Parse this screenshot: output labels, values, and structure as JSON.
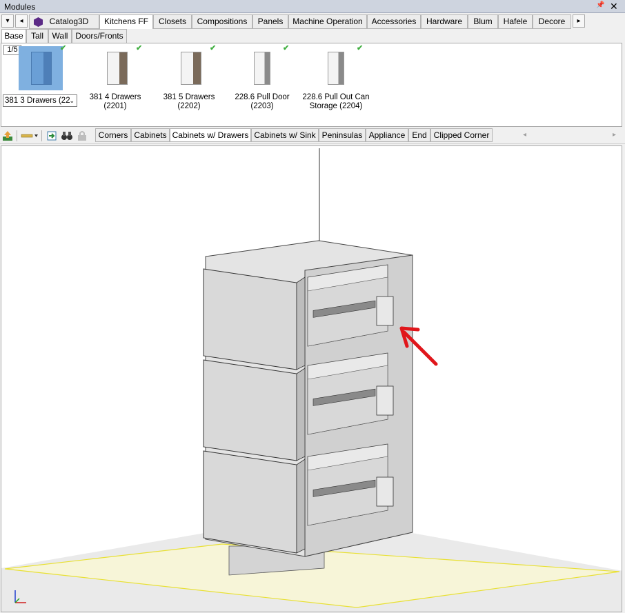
{
  "window": {
    "title": "Modules",
    "pin_glyph": "📌",
    "close_glyph": "✕"
  },
  "catalog_tabs": {
    "nav_down": "▾",
    "nav_left": "◂",
    "nav_right": "▸",
    "items": [
      {
        "label": "Catalog3D"
      },
      {
        "label": "Kitchens FF"
      },
      {
        "label": "Closets"
      },
      {
        "label": "Compositions"
      },
      {
        "label": "Panels"
      },
      {
        "label": "Machine Operation"
      },
      {
        "label": "Accessories"
      },
      {
        "label": "Hardware"
      },
      {
        "label": "Blum"
      },
      {
        "label": "Hafele"
      },
      {
        "label": "Decore"
      }
    ],
    "active": "Kitchens FF"
  },
  "sub_tabs": {
    "items": [
      {
        "label": "Base"
      },
      {
        "label": "Tall"
      },
      {
        "label": "Wall"
      },
      {
        "label": "Doors/Fronts"
      }
    ],
    "active": "Base"
  },
  "gallery": {
    "page_counter": "1/5",
    "items": [
      {
        "label": "381 3 Drawers (22",
        "selected": true
      },
      {
        "label": "381 4 Drawers (2201)"
      },
      {
        "label": "381 5 Drawers (2202)"
      },
      {
        "label": "228.6 Pull Door (2203)"
      },
      {
        "label": "228.6 Pull Out Can Storage (2204)"
      }
    ],
    "check_glyph": "✔",
    "combo_chevron": "⌄"
  },
  "category_tabs": {
    "items": [
      {
        "label": "Corners"
      },
      {
        "label": "Cabinets"
      },
      {
        "label": "Cabinets w/ Drawers"
      },
      {
        "label": "Cabinets w/ Sink"
      },
      {
        "label": "Peninsulas"
      },
      {
        "label": "Appliance"
      },
      {
        "label": "End"
      },
      {
        "label": "Clipped Corner"
      }
    ],
    "active": "Cabinets w/ Drawers",
    "scroll_left": "◂",
    "scroll_right": "▸"
  },
  "toolbar_icons": [
    "upload-icon",
    "ruler-icon",
    "insert-icon",
    "binoculars-icon",
    "lock-icon"
  ],
  "colors": {
    "floor": "#f7f5d8",
    "floor_border": "#e8e033",
    "cabinet": "#d9d9d9",
    "arrow": "#e0161b",
    "selection": "#7fb0e0"
  }
}
